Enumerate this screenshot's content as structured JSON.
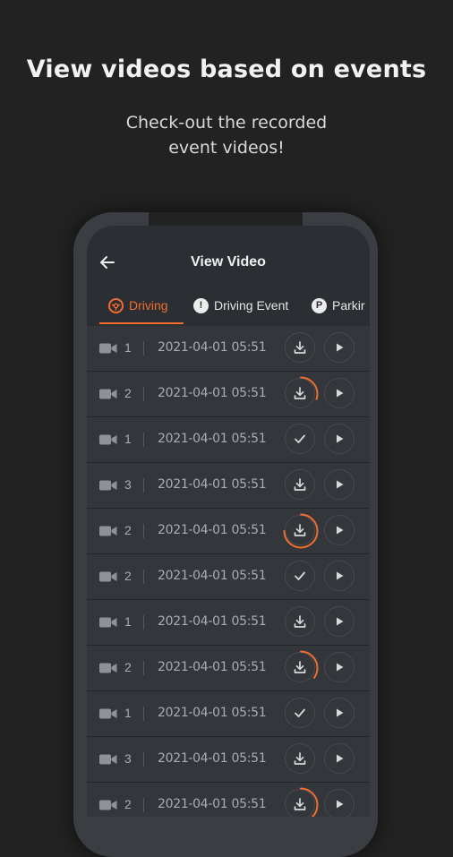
{
  "promo": {
    "headline": "View videos based on events",
    "subline_1": "Check-out the recorded",
    "subline_2": "event videos!"
  },
  "app": {
    "title": "View Video",
    "back_icon": "arrow-left-icon",
    "tabs": [
      {
        "label": "Driving",
        "icon": "driving-icon",
        "active": true
      },
      {
        "label": "Driving Event",
        "icon": "exclamation-icon",
        "glyph": "!",
        "active": false
      },
      {
        "label": "Parkir",
        "icon": "parking-icon",
        "glyph": "P",
        "active": false
      }
    ]
  },
  "colors": {
    "accent": "#f26d2e",
    "background": "#222222",
    "row": "#33363b",
    "text_muted": "#a9adb3"
  },
  "videos": [
    {
      "channel": "1",
      "datetime": "2021-04-01 05:51",
      "status": "download"
    },
    {
      "channel": "2",
      "datetime": "2021-04-01 05:51",
      "status": "downloading",
      "progress": 0.3
    },
    {
      "channel": "1",
      "datetime": "2021-04-01 05:51",
      "status": "downloaded"
    },
    {
      "channel": "3",
      "datetime": "2021-04-01 05:51",
      "status": "download"
    },
    {
      "channel": "2",
      "datetime": "2021-04-01 05:51",
      "status": "downloading",
      "progress": 0.75
    },
    {
      "channel": "2",
      "datetime": "2021-04-01 05:51",
      "status": "downloaded"
    },
    {
      "channel": "1",
      "datetime": "2021-04-01 05:51",
      "status": "download"
    },
    {
      "channel": "2",
      "datetime": "2021-04-01 05:51",
      "status": "downloading",
      "progress": 0.35
    },
    {
      "channel": "1",
      "datetime": "2021-04-01 05:51",
      "status": "downloaded"
    },
    {
      "channel": "3",
      "datetime": "2021-04-01 05:51",
      "status": "download"
    },
    {
      "channel": "2",
      "datetime": "2021-04-01 05:51",
      "status": "downloading",
      "progress": 0.55
    }
  ]
}
